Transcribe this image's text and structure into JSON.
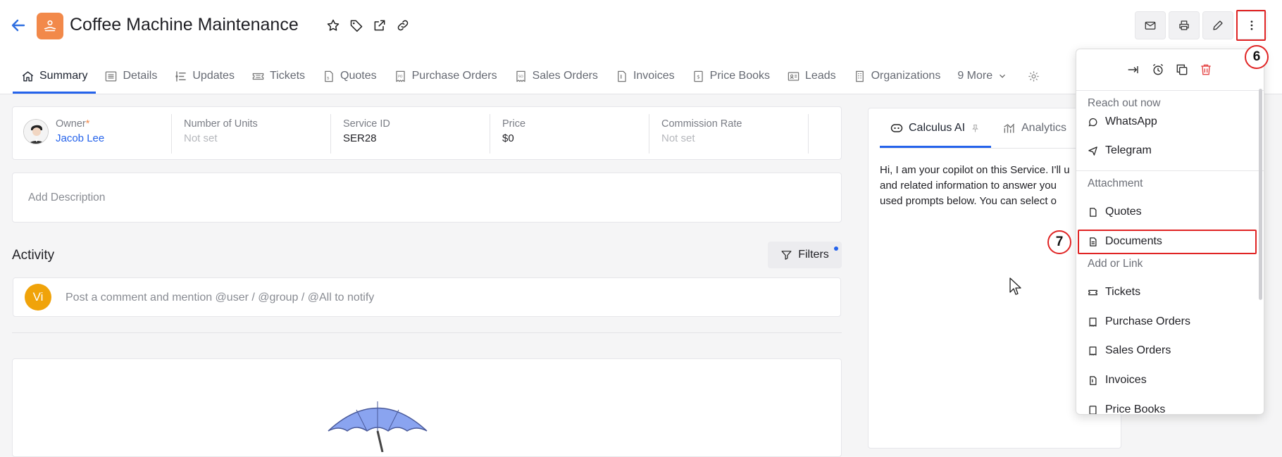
{
  "header": {
    "title": "Coffee Machine Maintenance",
    "icons": [
      "star-icon",
      "tag-icon",
      "external-link-icon",
      "link-icon"
    ]
  },
  "tabs": [
    {
      "label": "Summary",
      "icon": "home-icon",
      "active": true
    },
    {
      "label": "Details",
      "icon": "list-icon"
    },
    {
      "label": "Updates",
      "icon": "timeline-icon"
    },
    {
      "label": "Tickets",
      "icon": "ticket-icon"
    },
    {
      "label": "Quotes",
      "icon": "quote-icon"
    },
    {
      "label": "Purchase Orders",
      "icon": "po-icon"
    },
    {
      "label": "Sales Orders",
      "icon": "so-icon"
    },
    {
      "label": "Invoices",
      "icon": "invoice-icon"
    },
    {
      "label": "Price Books",
      "icon": "price-book-icon"
    },
    {
      "label": "Leads",
      "icon": "lead-icon"
    },
    {
      "label": "Organizations",
      "icon": "building-icon"
    },
    {
      "label": "9 More",
      "icon": "chevron-down-icon"
    }
  ],
  "fields": {
    "owner_label": "Owner",
    "owner_required": "*",
    "owner_value": "Jacob Lee",
    "units_label": "Number of Units",
    "units_value": "Not set",
    "service_label": "Service ID",
    "service_value": "SER28",
    "price_label": "Price",
    "price_value": "$0",
    "commission_label": "Commission Rate",
    "commission_value": "Not set"
  },
  "description_placeholder": "Add Description",
  "activity": {
    "title": "Activity",
    "filters_label": "Filters",
    "comment_avatar": "Vi",
    "comment_placeholder": "Post a comment and mention @user / @group / @All to notify"
  },
  "right_panel": {
    "tab1": "Calculus AI",
    "tab2": "Analytics",
    "text_lines": [
      "Hi, I am your copilot on this Service. I'll u",
      "and related information to answer you",
      "used prompts below. You can select o"
    ]
  },
  "menu": {
    "top_icons": [
      "unfollow-icon",
      "alarm-icon",
      "copy-icon",
      "trash-icon"
    ],
    "section1": "Reach out now",
    "whatsapp": "WhatsApp",
    "telegram": "Telegram",
    "section2": "Attachment",
    "quotes": "Quotes",
    "documents": "Documents",
    "section3": "Add or Link",
    "tickets": "Tickets",
    "purchase_orders": "Purchase Orders",
    "sales_orders": "Sales Orders",
    "invoices": "Invoices",
    "price_books": "Price Books"
  },
  "annotations": {
    "badge6": "6",
    "badge7": "7"
  },
  "colors": {
    "accent": "#2563eb",
    "app_icon": "#f2894a",
    "highlight": "#e02424",
    "avatar": "#f0a30a"
  }
}
